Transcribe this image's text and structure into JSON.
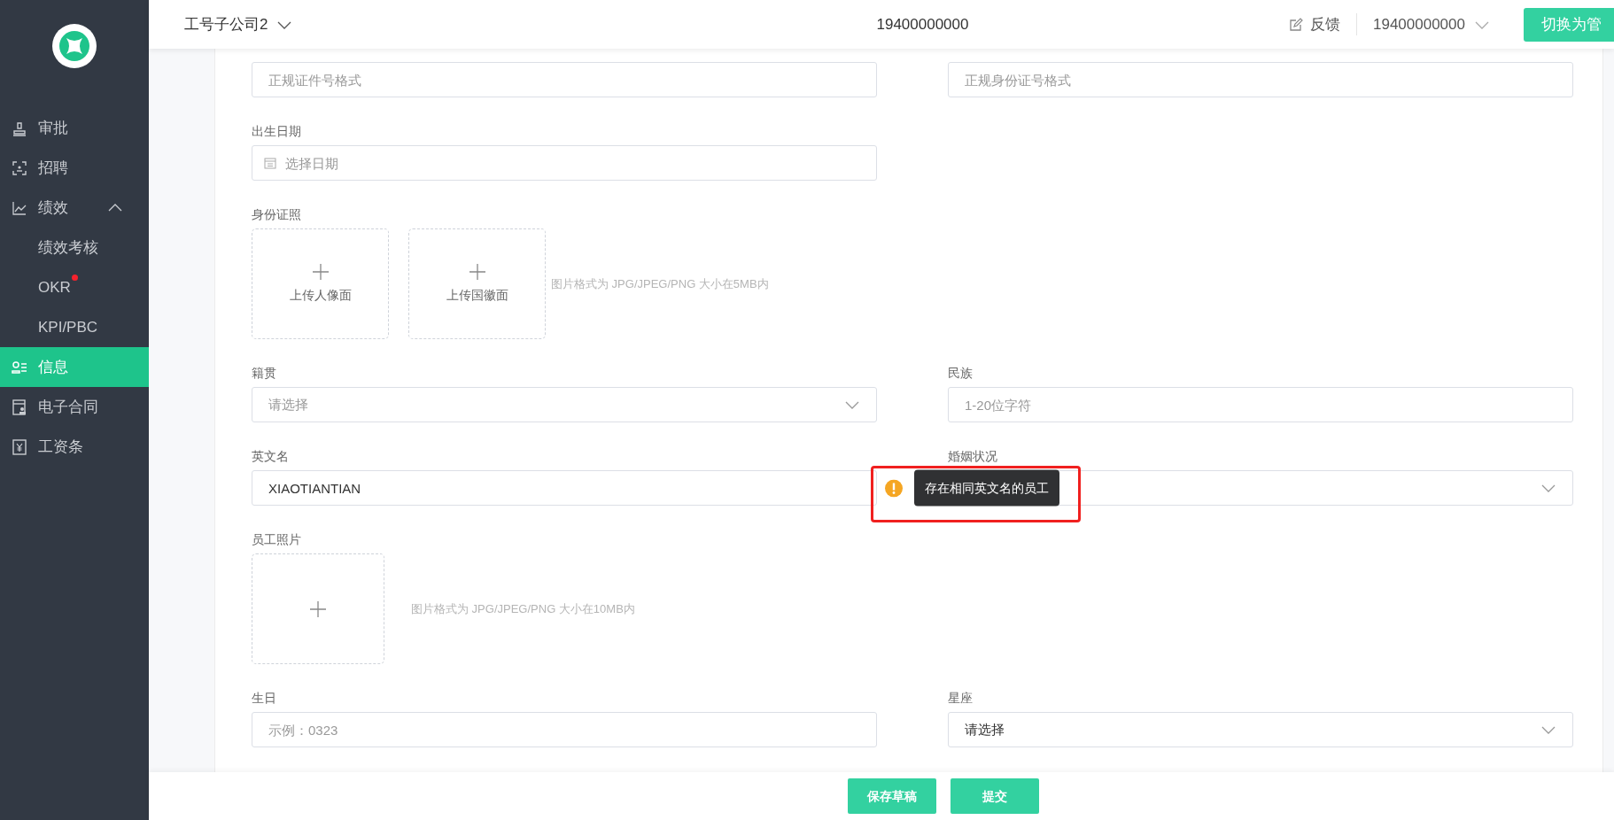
{
  "header": {
    "company": "工号子公司2",
    "center_number": "19400000000",
    "feedback": "反馈",
    "account": "19400000000",
    "switch_button": "切换为管"
  },
  "sidebar": {
    "items": [
      {
        "label": "审批",
        "kind": "stamp",
        "selected": false
      },
      {
        "label": "招聘",
        "kind": "scan",
        "selected": false
      },
      {
        "label": "绩效",
        "kind": "chart",
        "selected": false,
        "expanded": true,
        "children": [
          {
            "label": "绩效考核",
            "selected": false,
            "dot": false
          },
          {
            "label": "OKR",
            "selected": false,
            "dot": true
          },
          {
            "label": "KPI/PBC",
            "selected": false,
            "dot": false
          }
        ]
      },
      {
        "label": "信息",
        "kind": "person-list",
        "selected": true
      },
      {
        "label": "电子合同",
        "kind": "contract",
        "selected": false
      },
      {
        "label": "工资条",
        "kind": "yen",
        "selected": false
      }
    ]
  },
  "form": {
    "rows": [
      {
        "left": {
          "kind": "input",
          "placeholder": "正规证件号格式"
        },
        "right": {
          "kind": "input",
          "placeholder": "正规身份证号格式"
        }
      },
      {
        "left": {
          "label": "出生日期",
          "kind": "date",
          "placeholder": "选择日期"
        }
      },
      {
        "left": {
          "label": "身份证照",
          "kind": "upload",
          "tiles": [
            "上传人像面",
            "上传国徽面"
          ],
          "hint": "图片格式为 JPG/JPEG/PNG 大小在5MB内"
        }
      },
      {
        "left": {
          "label": "籍贯",
          "kind": "select",
          "placeholder": "请选择"
        },
        "right": {
          "label": "民族",
          "kind": "input",
          "placeholder": "1-20位字符"
        }
      },
      {
        "left": {
          "label": "英文名",
          "kind": "input",
          "value": "XIAOTIANTIAN",
          "warning": "存在相同英文名的员工"
        },
        "right": {
          "label": "婚姻状况",
          "kind": "select"
        }
      },
      {
        "left": {
          "label": "员工照片",
          "kind": "photo",
          "hint": "图片格式为 JPG/JPEG/PNG 大小在10MB内"
        }
      },
      {
        "left": {
          "label": "生日",
          "kind": "input",
          "placeholder": "示例：0323"
        },
        "right": {
          "label": "星座",
          "kind": "select",
          "value": "请选择"
        }
      }
    ]
  },
  "footer": {
    "buttons": [
      {
        "label": "保存草稿"
      },
      {
        "label": "提交"
      }
    ]
  }
}
